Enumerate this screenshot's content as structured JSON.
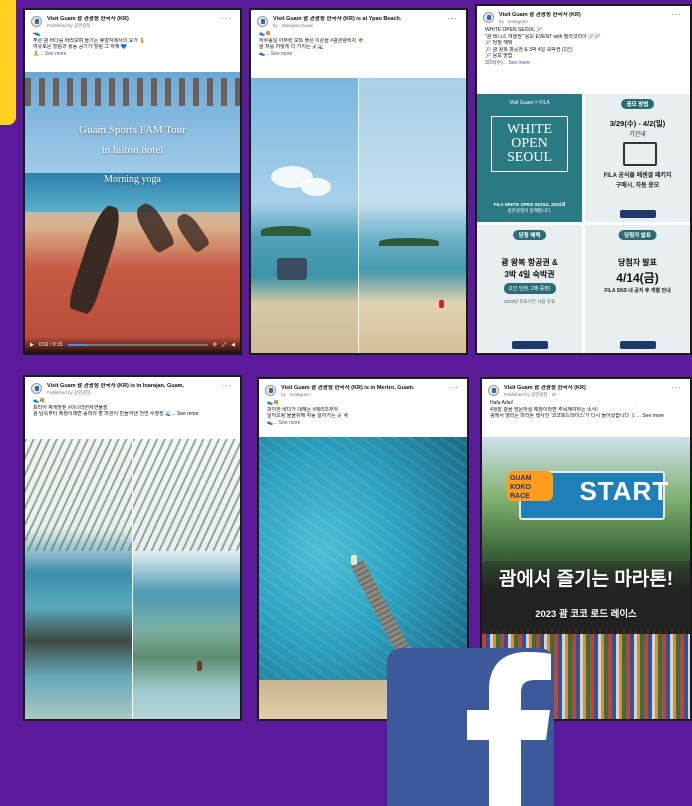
{
  "posts": [
    {
      "page_name": "Visit Guam 괌 관광청 한국사 (KR)",
      "sub": "Published by 괌관광청 · · ",
      "lines": [
        "•👟",
        "푸른 괌 바다를 바라보며 즐기는 휴양지에서의 요가 🧘",
        "여유로운 힐링과 활동 공기가 힐링 그 자체 💙"
      ],
      "see_more": "🧘... See more",
      "video": {
        "overlay_title": "Guam Sports FAM Tour",
        "overlay_line2": "in hilton hotel",
        "overlay_line3": "Morning yoga",
        "time": "0:02 / 0:15",
        "progress": 0.13
      }
    },
    {
      "page_name": "Visit Guam 괌 관광청 한국사 (KR) is at Ypao Beach.",
      "sub": "by · Mangilao Guam · ",
      "lines": [
        "👟💐",
        "하루종일 아무런 보트 좋은 이른을 #괌관광비치 🌴",
        "을 저를 어떻게 더 가지는 곳 🌊"
      ],
      "see_more": "👟... See more"
    },
    {
      "page_name": "Visit Guam 괌 관광청 한국사 (KR)",
      "sub": "by · Instagram · ",
      "lines": [
        "WHITE OPEN SEOUL 🎾",
        "\"괌 테니스 여행권\" 응모 EVENT with 필라코리아 🎾🎾",
        "",
        "🎾 당첨 혜택",
        "🎾 괌 왕복 항공권 & 3박 4일 숙박권 (1인)",
        "",
        "🎾 응모 방법",
        "3/29(수)... See more"
      ],
      "fila": {
        "tl_logo": "Visit Guam × FILA",
        "tl_title1": "WHITE",
        "tl_title2": "OPEN",
        "tl_title3": "SEOUL",
        "tl_caption1": "FILA WHITE OPEN SEOUL 2023과",
        "tl_caption2": "괌관광청이 함께합니다.",
        "tr_pill": "응모 방법",
        "tr_date": "3/29(수) - 4/2(일)",
        "tr_period": "기간내",
        "tr_line1": "FILA 공식몰 에센셜 패키지",
        "tr_line2": "구매시, 자동 응모",
        "bl_pill": "당첨 혜택",
        "bl_line1": "괌 왕복 항공권 &",
        "bl_line2": "3박 4일 숙박권",
        "bl_badge": "(1인 당첨, 2매 증정)",
        "bl_note": "2023년 유효기간 사용 유효",
        "br_pill": "당첨자 발표",
        "br_line1": "당첨자 발표",
        "br_line2": "4/14(금)",
        "br_line3": "FILA SNS 내 공지 후 개별 안내"
      }
    },
    {
      "page_name": "Visit Guam 괌 관광청 한국사 (KR) is in Inarajan, Guam.",
      "sub": "Published by 괌관광청 · · ",
      "lines": [
        "👟💐",
        "포티어 짜게장된 #이나라한자연풀장",
        "괌 남쪽부터 해정이래면 홀려야 할 마관이 만들어낸 천연 수영장 🌊... See more"
      ],
      "see_more": ""
    },
    {
      "page_name": "Visit Guam 괌 관광청 한국사 (KR) is in Merizo, Guam.",
      "sub": "by · Instagram · ",
      "lines": [
        "👟💐",
        "파이한 바다가 대해는 #메리조부두",
        "일어오랑 물물위해 자동 알아가는 곳 🌴",
        "👟... See more"
      ],
      "see_more": ""
    },
    {
      "page_name": "Visit Guam 괌 관광청 한국사 (KR)",
      "sub": "Published by 괌관광청 · 2h · ",
      "lines": [
        "Hafa Adai!",
        "4월말 괌을 방문하실 예정이라면 주목해야하는 소식!",
        "괌에서 열리는 마라톤 행사인 '코코로드레이스'가 다시 돌아왔습니다 🏃... See more"
      ],
      "see_more": "",
      "marathon": {
        "arch_text": "START",
        "logo_line1": "GUAM",
        "logo_line2": "KOKO",
        "logo_line3": "RACE",
        "title": "괌에서 즐기는 마라톤!",
        "subtitle": "2023 괌 코코 로드 레이스"
      }
    }
  ],
  "colors": {
    "background": "#5b1a99",
    "accent_yellow": "#ffd21f",
    "facebook_blue": "#3c5a9a",
    "link_blue": "#385898"
  },
  "icons": {
    "facebook_logo": "facebook-logo",
    "more": "more-horizontal-icon",
    "play": "play-icon"
  }
}
